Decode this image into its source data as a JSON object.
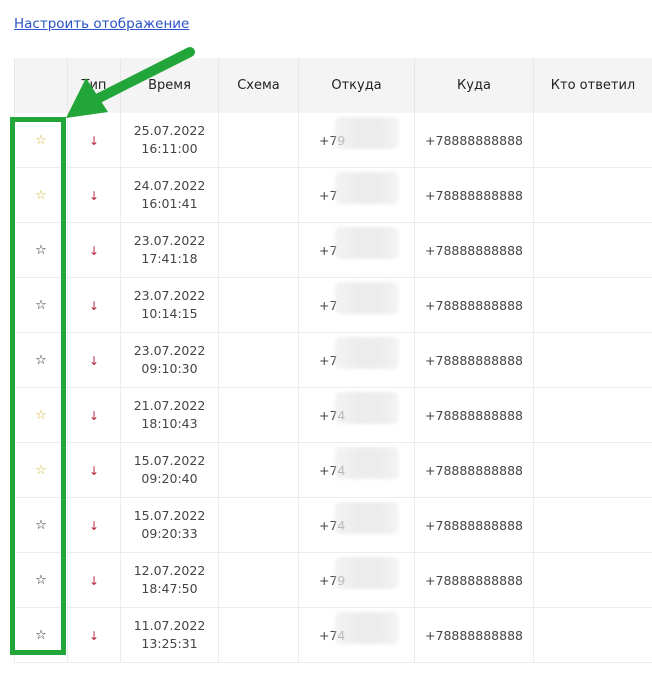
{
  "top_link": "Настроить отображение",
  "columns": [
    "",
    "Тип",
    "Время",
    "Схема",
    "Откуда",
    "Куда",
    "Кто ответил"
  ],
  "rows": [
    {
      "starred": true,
      "date": "25.07.2022",
      "time": "16:11:00",
      "from": "+79",
      "to": "+78888888888"
    },
    {
      "starred": true,
      "date": "24.07.2022",
      "time": "16:01:41",
      "from": "+7",
      "to": "+78888888888"
    },
    {
      "starred": false,
      "date": "23.07.2022",
      "time": "17:41:18",
      "from": "+7",
      "to": "+78888888888"
    },
    {
      "starred": false,
      "date": "23.07.2022",
      "time": "10:14:15",
      "from": "+7",
      "to": "+78888888888"
    },
    {
      "starred": false,
      "date": "23.07.2022",
      "time": "09:10:30",
      "from": "+7",
      "to": "+78888888888"
    },
    {
      "starred": true,
      "date": "21.07.2022",
      "time": "18:10:43",
      "from": "+74",
      "to": "+78888888888"
    },
    {
      "starred": true,
      "date": "15.07.2022",
      "time": "09:20:40",
      "from": "+74",
      "to": "+78888888888"
    },
    {
      "starred": false,
      "date": "15.07.2022",
      "time": "09:20:33",
      "from": "+74",
      "to": "+78888888888"
    },
    {
      "starred": false,
      "date": "12.07.2022",
      "time": "18:47:50",
      "from": "+79",
      "to": "+78888888888"
    },
    {
      "starred": false,
      "date": "11.07.2022",
      "time": "13:25:31",
      "from": "+74",
      "to": "+78888888888"
    }
  ],
  "icons": {
    "star_filled": "star-icon",
    "star_empty": "star-outline-icon",
    "incoming": "arrow-down-icon"
  },
  "colors": {
    "star_active": "#d6b430",
    "incoming_arrow": "#b5283e",
    "highlight": "#22a63a",
    "link": "#2a54c7"
  }
}
